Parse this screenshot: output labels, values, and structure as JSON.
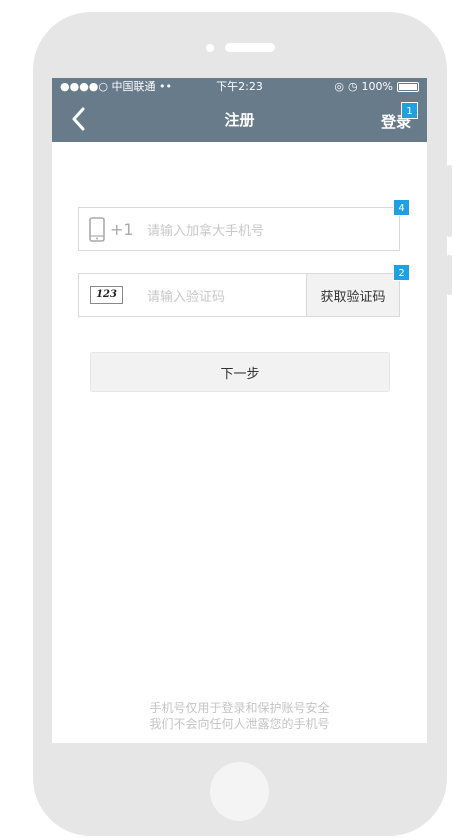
{
  "status_bar": {
    "carrier": "●●●●○ 中国联通",
    "time": "下午2:23",
    "battery": "100%"
  },
  "nav": {
    "title": "注册",
    "login_label": "登录"
  },
  "form": {
    "phone_prefix": "+1",
    "phone_placeholder": "请输入加拿大手机号",
    "phone_value": "",
    "code_icon_text": "123",
    "code_placeholder": "请输入验证码",
    "code_value": "",
    "get_code_label": "获取验证码",
    "next_label": "下一步"
  },
  "badges": {
    "login": "1",
    "phone": "4",
    "get_code": "2"
  },
  "footer": {
    "line1": "手机号仅用于登录和保护账号安全",
    "line2": "我们不会向任何人泄露您的手机号"
  },
  "colors": {
    "nav_bg": "#687b8b",
    "badge_bg": "#1da1e0",
    "phone_frame": "#e6e6e6"
  }
}
